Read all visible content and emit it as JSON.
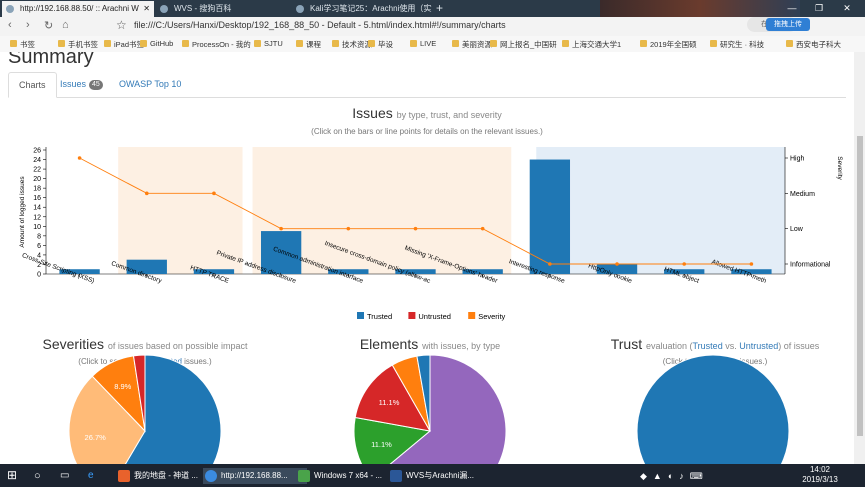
{
  "browser": {
    "tabs": [
      {
        "label": "http://192.168.88.50/ :: Arachni W",
        "active": true
      },
      {
        "label": "WVS - 搜狗百科",
        "active": false
      },
      {
        "label": "Kali学习笔记25：Arachni使用（实测",
        "active": false
      }
    ],
    "new_tab": "+",
    "url": "file:///C:/Users/Hanxi/Desktop/192_168_88_50 - Default - 5.html/index.html#!/summary/charts",
    "search_placeholder": "在此搜索",
    "upload_button": "拖拽上传",
    "bookmarks": [
      "书签",
      "手机书签",
      "iPad书签",
      "GitHub",
      "ProcessOn - 我的",
      "SJTU",
      "课程",
      "技术资源",
      "毕设",
      "LIVE",
      "美丽资源",
      "网上报名_中国研",
      "上海交通大学1",
      "2019年全国硕",
      "研究生 · 科技",
      "西安电子科大"
    ]
  },
  "page": {
    "heading": "Summary",
    "tabs": {
      "charts": "Charts",
      "issues": "Issues",
      "issues_count": "45",
      "owasp": "OWASP Top 10"
    }
  },
  "issues_chart": {
    "title": "Issues",
    "subtitle": "by type, trust, and severity",
    "hint": "(Click on the bars or line points for details on the relevant issues.)",
    "ylabel": "Amount of logged issues",
    "y2label": "Severity"
  },
  "chart_data": [
    {
      "type": "bar",
      "title": "Issues",
      "ylabel": "Amount of logged issues",
      "ylim": [
        0,
        26
      ],
      "yticks": [
        0,
        2,
        4,
        6,
        8,
        10,
        12,
        14,
        16,
        18,
        20,
        22,
        24,
        26
      ],
      "categories": [
        "Cross-Site Scripting (XSS)",
        "Common directory",
        "HTTP TRACE",
        "Private IP address disclosure",
        "Common administration interface",
        "Insecure cross-domain policy (allow-ac",
        "Missing 'X-Frame-Options' header",
        "Interesting response",
        "HttpOnly cookie",
        "HTML object",
        "Allowed HTTP meth"
      ],
      "series": [
        {
          "name": "Trusted",
          "color": "#1f77b4",
          "values": [
            1,
            3,
            1,
            9,
            1,
            1,
            1,
            24,
            2,
            1,
            1
          ]
        },
        {
          "name": "Untrusted",
          "color": "#d62728",
          "values": [
            0,
            0,
            0,
            0,
            0,
            0,
            0,
            0,
            0,
            0,
            0
          ]
        },
        {
          "name": "Severity",
          "color": "#ff7f0e",
          "type": "line",
          "axis": "right",
          "values": [
            "High",
            "Medium",
            "Medium",
            "Low",
            "Low",
            "Low",
            "Low",
            "Informational",
            "Informational",
            "Informational",
            "Informational"
          ]
        }
      ],
      "severity_levels": [
        "Informational",
        "Low",
        "Medium",
        "High"
      ],
      "legend": "bottom"
    },
    {
      "type": "pie",
      "title": "Severities",
      "slices": [
        {
          "color": "#1f77b4",
          "value": 53.3
        },
        {
          "color": "#ffbb78",
          "value": 26.7,
          "label": "26.7%"
        },
        {
          "color": "#ff7f0e",
          "value": 8.9,
          "label": "8.9%"
        },
        {
          "color": "#d62728",
          "value": 2.2
        }
      ]
    },
    {
      "type": "pie",
      "title": "Elements",
      "slices": [
        {
          "color": "#9467bd",
          "value": 51.1
        },
        {
          "color": "#2ca02c",
          "value": 11.1,
          "label": "11.1%"
        },
        {
          "color": "#d62728",
          "value": 11.1,
          "label": "11.1%"
        },
        {
          "color": "#ff7f0e",
          "value": 4.4
        },
        {
          "color": "#1f77b4",
          "value": 2.2
        }
      ]
    },
    {
      "type": "pie",
      "title": "Trust",
      "slices": [
        {
          "color": "#1f77b4",
          "value": 100
        }
      ]
    }
  ],
  "severities_chart": {
    "title": "Severities",
    "subtitle": "of issues based on possible impact",
    "hint_pre": "(Click to see relevant ",
    "hint_link": "Trusted",
    "hint_post": " issues.)"
  },
  "elements_chart": {
    "title": "Elements",
    "subtitle": "with issues, by type"
  },
  "trust_chart": {
    "title": "Trust",
    "sub_pre": "evaluation (",
    "sub_trusted": "Trusted",
    "sub_vs": " vs. ",
    "sub_untrusted": "Untrusted",
    "sub_post": ") of issues",
    "hint": "(Click to see relevant issues.)"
  },
  "taskbar": {
    "items": [
      "我的地盘 - 神道 ...",
      "http://192.168.88...",
      "Windows 7 x64 - ...",
      "WVS与Arachni漏..."
    ],
    "time": "14:02",
    "date": "2019/3/13"
  }
}
